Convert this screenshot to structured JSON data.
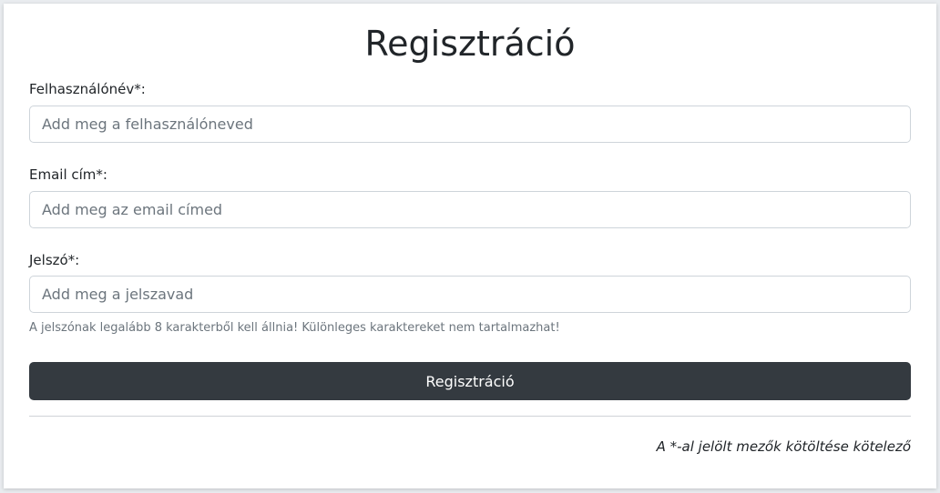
{
  "form": {
    "title": "Regisztráció",
    "username": {
      "label": "Felhasználónév*:",
      "placeholder": "Add meg a felhasználóneved",
      "value": ""
    },
    "email": {
      "label": "Email cím*:",
      "placeholder": "Add meg az email címed",
      "value": ""
    },
    "password": {
      "label": "Jelszó*:",
      "placeholder": "Add meg a jelszavad",
      "value": "",
      "hint": "A jelszónak legalább 8 karakterből kell állnia! Különleges karaktereket nem tartalmazhat!"
    },
    "submit_label": "Regisztráció",
    "required_note": "A *-al jelölt mezők kötöltése kötelező"
  },
  "colors": {
    "button_bg": "#343a40",
    "button_text": "#ffffff",
    "input_border": "#ced4da",
    "placeholder": "#6c757d",
    "hint_text": "#6c757d"
  }
}
